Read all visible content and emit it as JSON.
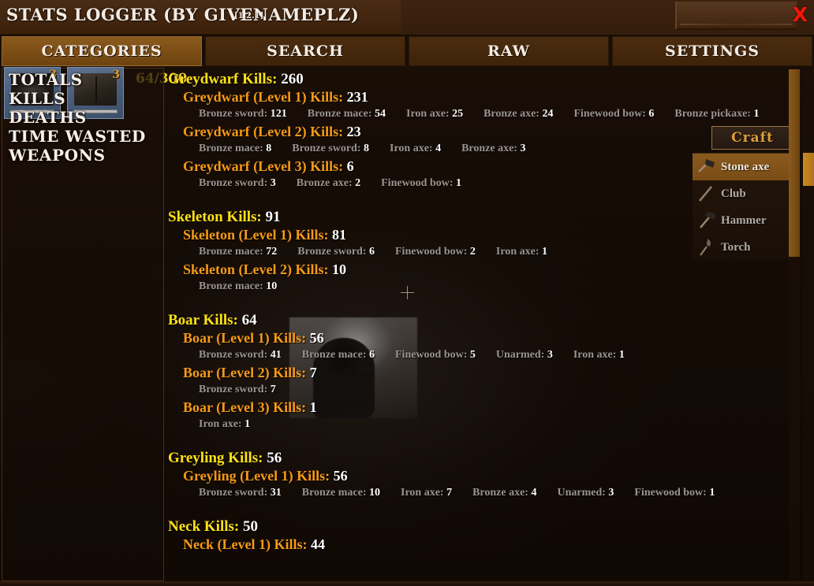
{
  "window": {
    "title": "Stats Logger (by givenameplz)",
    "version": "[1.2.1]",
    "close_label": "X"
  },
  "tabs": [
    {
      "label": "Categories",
      "active": true
    },
    {
      "label": "Search",
      "active": false
    },
    {
      "label": "Raw",
      "active": false
    },
    {
      "label": "Settings",
      "active": false
    }
  ],
  "sidebar": {
    "items": [
      {
        "label": "Totals"
      },
      {
        "label": "Kills"
      },
      {
        "label": "Deaths"
      },
      {
        "label": "Time Wasted"
      },
      {
        "label": "Weapons"
      }
    ]
  },
  "inventory": {
    "slots": [
      {
        "quantity": "3",
        "icon": "cape-item-icon"
      },
      {
        "quantity": "3",
        "icon": "book-item-icon"
      }
    ]
  },
  "hud": {
    "weight": "64/300"
  },
  "craft": {
    "button_label": "Craft",
    "items": [
      {
        "label": "Stone axe",
        "icon": "axe-icon",
        "selected": true
      },
      {
        "label": "Club",
        "icon": "club-icon",
        "selected": false
      },
      {
        "label": "Hammer",
        "icon": "hammer-icon",
        "selected": false
      },
      {
        "label": "Torch",
        "icon": "torch-icon",
        "selected": false
      }
    ]
  },
  "stats": {
    "groups": [
      {
        "title": "Greydwarf Kills:",
        "total": "260",
        "levels": [
          {
            "title": "Greydwarf (Level 1) Kills:",
            "count": "231",
            "weapons": [
              {
                "name": "Bronze sword:",
                "count": "121"
              },
              {
                "name": "Bronze mace:",
                "count": "54"
              },
              {
                "name": "Iron axe:",
                "count": "25"
              },
              {
                "name": "Bronze axe:",
                "count": "24"
              },
              {
                "name": "Finewood bow:",
                "count": "6"
              },
              {
                "name": "Bronze pickaxe:",
                "count": "1"
              }
            ]
          },
          {
            "title": "Greydwarf (Level 2) Kills:",
            "count": "23",
            "weapons": [
              {
                "name": "Bronze mace:",
                "count": "8"
              },
              {
                "name": "Bronze sword:",
                "count": "8"
              },
              {
                "name": "Iron axe:",
                "count": "4"
              },
              {
                "name": "Bronze axe:",
                "count": "3"
              }
            ]
          },
          {
            "title": "Greydwarf (Level 3) Kills:",
            "count": "6",
            "weapons": [
              {
                "name": "Bronze sword:",
                "count": "3"
              },
              {
                "name": "Bronze axe:",
                "count": "2"
              },
              {
                "name": "Finewood bow:",
                "count": "1"
              }
            ]
          }
        ]
      },
      {
        "title": "Skeleton Kills:",
        "total": "91",
        "levels": [
          {
            "title": "Skeleton (Level 1) Kills:",
            "count": "81",
            "weapons": [
              {
                "name": "Bronze mace:",
                "count": "72"
              },
              {
                "name": "Bronze sword:",
                "count": "6"
              },
              {
                "name": "Finewood bow:",
                "count": "2"
              },
              {
                "name": "Iron axe:",
                "count": "1"
              }
            ]
          },
          {
            "title": "Skeleton (Level 2) Kills:",
            "count": "10",
            "weapons": [
              {
                "name": "Bronze mace:",
                "count": "10"
              }
            ]
          }
        ]
      },
      {
        "title": "Boar Kills:",
        "total": "64",
        "levels": [
          {
            "title": "Boar (Level 1) Kills:",
            "count": "56",
            "weapons": [
              {
                "name": "Bronze sword:",
                "count": "41"
              },
              {
                "name": "Bronze mace:",
                "count": "6"
              },
              {
                "name": "Finewood bow:",
                "count": "5"
              },
              {
                "name": "Unarmed:",
                "count": "3"
              },
              {
                "name": "Iron axe:",
                "count": "1"
              }
            ]
          },
          {
            "title": "Boar (Level 2) Kills:",
            "count": "7",
            "weapons": [
              {
                "name": "Bronze sword:",
                "count": "7"
              }
            ]
          },
          {
            "title": "Boar (Level 3) Kills:",
            "count": "1",
            "weapons": [
              {
                "name": "Iron axe:",
                "count": "1"
              }
            ]
          }
        ]
      },
      {
        "title": "Greyling Kills:",
        "total": "56",
        "levels": [
          {
            "title": "Greyling (Level 1) Kills:",
            "count": "56",
            "weapons": [
              {
                "name": "Bronze sword:",
                "count": "31"
              },
              {
                "name": "Bronze mace:",
                "count": "10"
              },
              {
                "name": "Iron axe:",
                "count": "7"
              },
              {
                "name": "Bronze axe:",
                "count": "4"
              },
              {
                "name": "Unarmed:",
                "count": "3"
              },
              {
                "name": "Finewood bow:",
                "count": "1"
              }
            ]
          }
        ]
      },
      {
        "title": "Neck Kills:",
        "total": "50",
        "levels": [
          {
            "title": "Neck (Level 1) Kills:",
            "count": "44",
            "weapons": []
          }
        ]
      }
    ]
  },
  "colors": {
    "group_title": "#ffe215",
    "level_title": "#f79a16",
    "weapon_name": "#9b9490",
    "value": "#ffffff",
    "accent": "#8a5a1e",
    "close": "#f51505"
  }
}
